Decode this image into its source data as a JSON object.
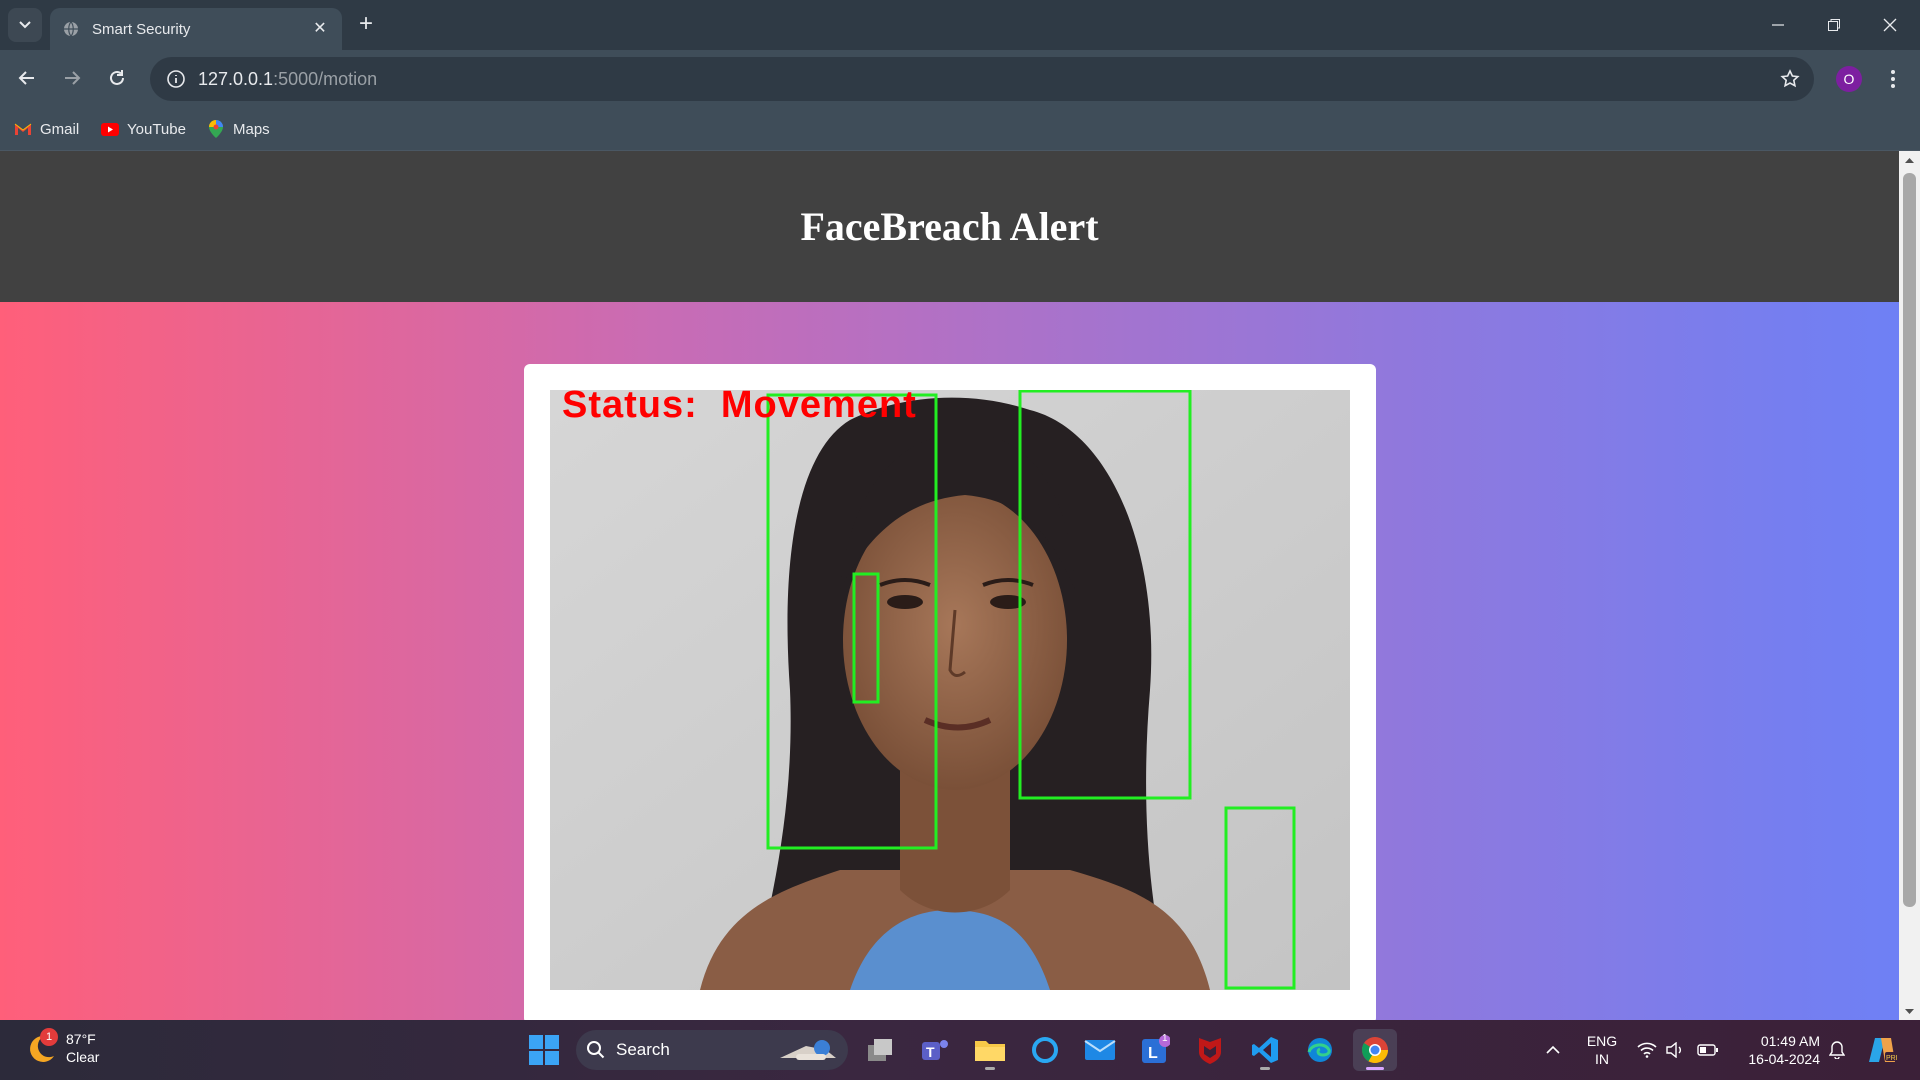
{
  "browser": {
    "tab_title": "Smart Security",
    "url_host": "127.0.0.1",
    "url_path": ":5000/motion",
    "profile_initial": "O",
    "bookmarks": [
      {
        "label": "Gmail",
        "icon": "gmail-icon"
      },
      {
        "label": "YouTube",
        "icon": "youtube-icon"
      },
      {
        "label": "Maps",
        "icon": "maps-icon"
      }
    ]
  },
  "page": {
    "title": "FaceBreach Alert",
    "feed_status_text": "Status:  Movement",
    "colors": {
      "header_bg": "#414141",
      "gradient_left": "#ff5f7a",
      "gradient_right": "#6e80f5",
      "detection_box": "#22ee22",
      "status_text": "#ff0000"
    }
  },
  "taskbar": {
    "weather_temp": "87°F",
    "weather_desc": "Clear",
    "weather_badge": "1",
    "search_placeholder": "Search",
    "lang_line1": "ENG",
    "lang_line2": "IN",
    "time": "01:49 AM",
    "date": "16-04-2024",
    "apps": [
      {
        "name": "task-view-icon"
      },
      {
        "name": "teams-icon"
      },
      {
        "name": "file-explorer-icon"
      },
      {
        "name": "cortana-icon"
      },
      {
        "name": "mail-icon"
      },
      {
        "name": "linkedin-icon",
        "badge": "1"
      },
      {
        "name": "mcafee-icon"
      },
      {
        "name": "vscode-icon"
      },
      {
        "name": "edge-icon"
      },
      {
        "name": "chrome-icon"
      }
    ]
  }
}
